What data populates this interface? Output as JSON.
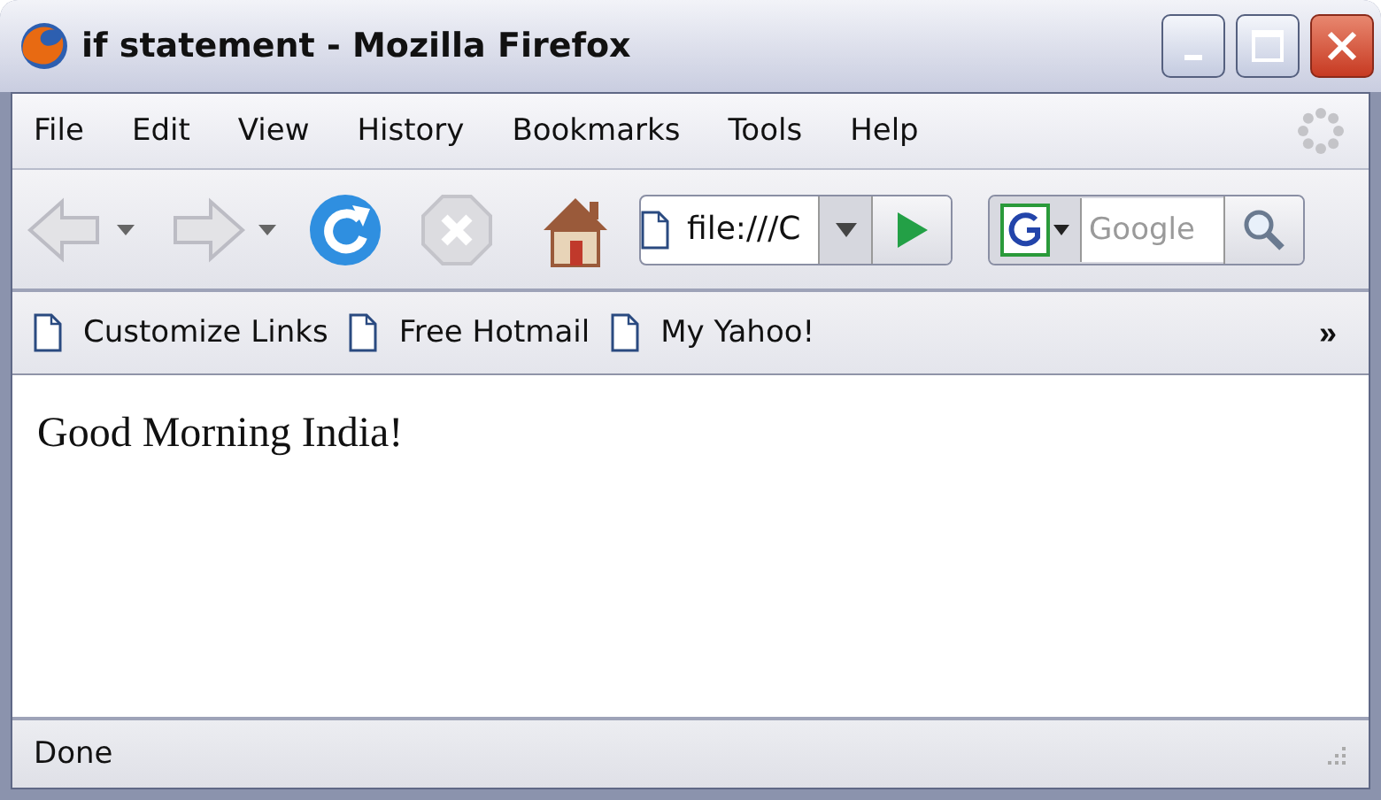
{
  "window": {
    "title": "if statement - Mozilla Firefox"
  },
  "menu": [
    "File",
    "Edit",
    "View",
    "History",
    "Bookmarks",
    "Tools",
    "Help"
  ],
  "address": {
    "value": "file:///C"
  },
  "search": {
    "placeholder": "Google"
  },
  "bookmarks": [
    "Customize Links",
    "Free Hotmail",
    "My Yahoo!"
  ],
  "overflow": "»",
  "content": {
    "text": "Good Morning India!"
  },
  "status_bar": {
    "text": "Done"
  }
}
